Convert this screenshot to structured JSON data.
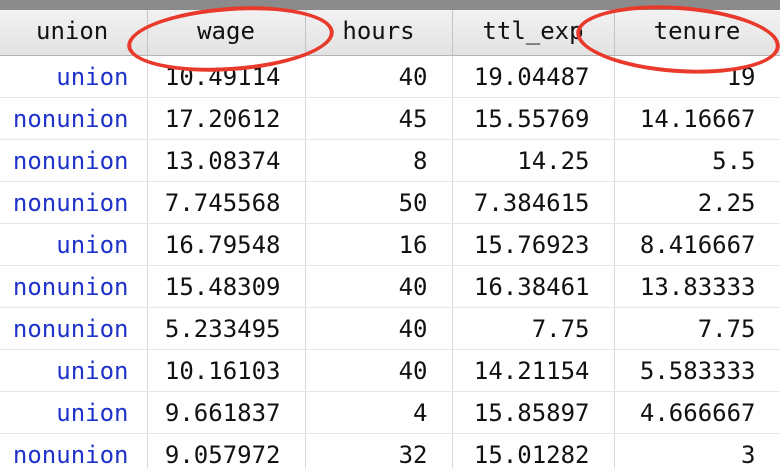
{
  "columns": {
    "union": "union",
    "wage": "wage",
    "hours": "hours",
    "ttl_exp": "ttl_exp",
    "tenure": "tenure"
  },
  "rows": [
    {
      "union": "union",
      "wage": "10.49114",
      "hours": "40",
      "ttl_exp": "19.04487",
      "tenure": "19"
    },
    {
      "union": "nonunion",
      "wage": "17.20612",
      "hours": "45",
      "ttl_exp": "15.55769",
      "tenure": "14.16667"
    },
    {
      "union": "nonunion",
      "wage": "13.08374",
      "hours": "8",
      "ttl_exp": "14.25",
      "tenure": "5.5"
    },
    {
      "union": "nonunion",
      "wage": "7.745568",
      "hours": "50",
      "ttl_exp": "7.384615",
      "tenure": "2.25"
    },
    {
      "union": "union",
      "wage": "16.79548",
      "hours": "16",
      "ttl_exp": "15.76923",
      "tenure": "8.416667"
    },
    {
      "union": "nonunion",
      "wage": "15.48309",
      "hours": "40",
      "ttl_exp": "16.38461",
      "tenure": "13.83333"
    },
    {
      "union": "nonunion",
      "wage": "5.233495",
      "hours": "40",
      "ttl_exp": "7.75",
      "tenure": "7.75"
    },
    {
      "union": "union",
      "wage": "10.16103",
      "hours": "40",
      "ttl_exp": "14.21154",
      "tenure": "5.583333"
    },
    {
      "union": "union",
      "wage": "9.661837",
      "hours": "4",
      "ttl_exp": "15.85897",
      "tenure": "4.666667"
    },
    {
      "union": "nonunion",
      "wage": "9.057972",
      "hours": "32",
      "ttl_exp": "15.01282",
      "tenure": "3"
    }
  ],
  "colors": {
    "value_label": "#1f32c9",
    "annotation": "#e8392a",
    "header_bg": "#e8e8e8"
  }
}
